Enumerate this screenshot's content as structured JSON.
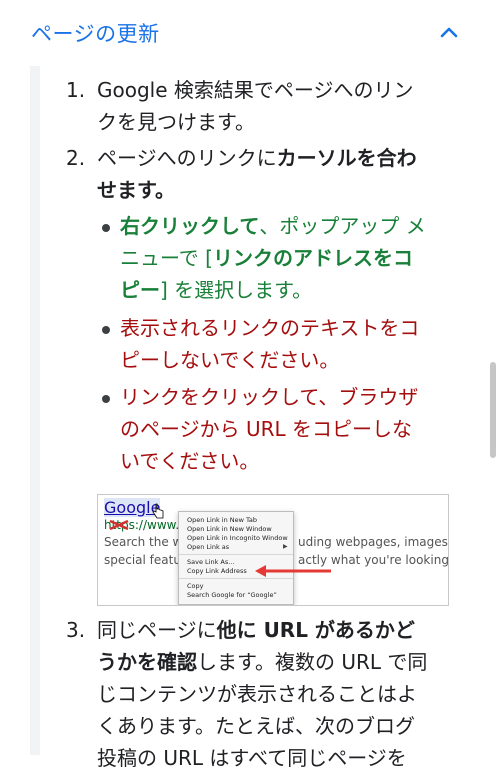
{
  "header": {
    "title": "ページの更新",
    "caret_icon": "chevron-up-icon",
    "accent": "#1a73e8"
  },
  "steps": [
    {
      "number": "1.",
      "line1": "Google 検索結果でページへのリン",
      "line2": "クを見つけます。"
    },
    {
      "number": "2.",
      "line1_plain": "ページへのリンクに",
      "line1_bold": "カーソルを合わ",
      "line2_bold": "せます。"
    },
    {
      "number": "3.",
      "line1_plain": "同じページに",
      "line1_bold": "他に URL があるかど",
      "line2_bold": "うかを確認",
      "line2_plain": "します。複数の URL で同",
      "line3": "じコンテンツが表示されることはよ",
      "line4": "くあります。たとえば、次のブログ",
      "line5": "投稿の URL はすべて同じページを"
    }
  ],
  "sub_items": [
    {
      "color": "#188038",
      "line1_bold": "右クリックして",
      "line1_plain": "、ポップアップ メ",
      "line2_plain": "ニューで [",
      "line2_bold": "リンクのアドレスをコ",
      "line3_bold": "ピー",
      "line3_plain": "] を選択します。"
    },
    {
      "color": "#a50e0e",
      "line1": "表示されるリンクのテキストをコ",
      "line2": "ピーしないでください。"
    },
    {
      "color": "#a50e0e",
      "line1": "リンクをクリックして、ブラウザ",
      "line2": "のページから URL をコピーしな",
      "line3": "いでください。"
    }
  ],
  "screenshot": {
    "link_text": "Google",
    "url_text": "https://www.g",
    "snippet1_left": "Search the wo",
    "snippet1_right": "uding webpages, images, vid",
    "snippet2_left": "special featur",
    "snippet2_right": "actly what you're looking ...",
    "menu": [
      "Open Link in New Tab",
      "Open Link in New Window",
      "Open Link in Incognito Window",
      "Open Link as",
      "Save Link As...",
      "Copy Link Address",
      "Copy",
      "Search Google for “Google”"
    ],
    "highlight_color": "#e53935"
  }
}
